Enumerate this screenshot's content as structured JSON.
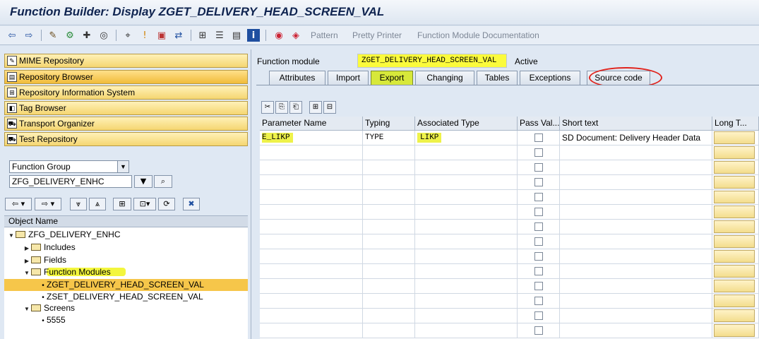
{
  "window": {
    "title": "Function Builder: Display ZGET_DELIVERY_HEAD_SCREEN_VAL"
  },
  "toolbar": {
    "buttons": [
      "back-icon",
      "forward-icon",
      "other-object-icon",
      "display-change-icon",
      "activate-icon",
      "check-icon",
      "where-used-icon",
      "navigation-icon",
      "mark-icon",
      "display-object-list-icon",
      "hierarchy-icon",
      "stack-icon",
      "info-icon",
      "test-icon",
      "pattern-icon"
    ],
    "pattern": "Pattern",
    "pretty_printer": "Pretty Printer",
    "documentation": "Function Module Documentation"
  },
  "nav": {
    "items": [
      {
        "label": "MIME Repository",
        "icon": "mime-icon"
      },
      {
        "label": "Repository Browser",
        "icon": "browser-icon"
      },
      {
        "label": "Repository Information System",
        "icon": "info-system-icon"
      },
      {
        "label": "Tag Browser",
        "icon": "tag-icon"
      },
      {
        "label": "Transport Organizer",
        "icon": "transport-icon"
      },
      {
        "label": "Test Repository",
        "icon": "test-icon"
      }
    ],
    "object_type": "Function Group",
    "object_name": "ZFG_DELIVERY_ENHC"
  },
  "tree": {
    "header": "Object Name",
    "root": "ZFG_DELIVERY_ENHC",
    "includes": "Includes",
    "fields": "Fields",
    "function_modules": "Function Modules",
    "fm1": "ZGET_DELIVERY_HEAD_SCREEN_VAL",
    "fm2": "ZSET_DELIVERY_HEAD_SCREEN_VAL",
    "screens": "Screens",
    "screen1": "5555"
  },
  "header": {
    "label": "Function module",
    "value": "ZGET_DELIVERY_HEAD_SCREEN_VAL",
    "status": "Active"
  },
  "tabs": [
    "Attributes",
    "Import",
    "Export",
    "Changing",
    "Tables",
    "Exceptions",
    "Source code"
  ],
  "active_tab": "Export",
  "grid": {
    "columns": [
      "Parameter Name",
      "Typing",
      "Associated Type",
      "Pass Val...",
      "Short text",
      "Long T..."
    ],
    "rows": [
      {
        "param": "E_LIKP",
        "typing": "TYPE",
        "assoc": "LIKP",
        "pass_value": false,
        "short": "SD Document: Delivery Header Data"
      }
    ]
  },
  "colors": {
    "highlight": "#eef24a",
    "selection": "#f6c64a",
    "annotation": "#e0241d"
  }
}
